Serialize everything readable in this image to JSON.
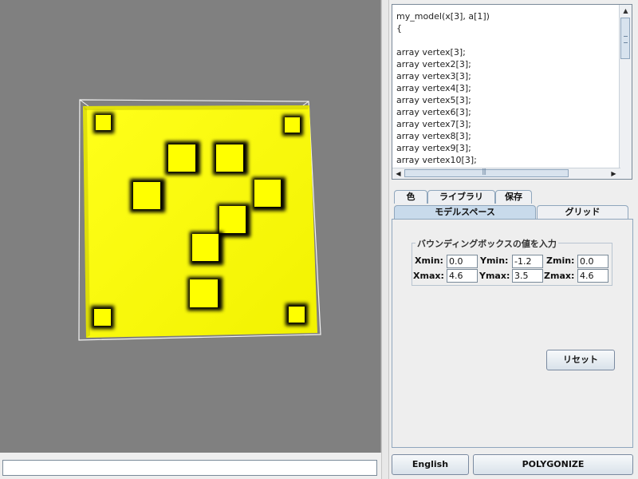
{
  "code_editor": {
    "lines": [
      "my_model(x[3], a[1])",
      "{",
      "",
      "array vertex[3];",
      "array vertex2[3];",
      "array vertex3[3];",
      "array vertex4[3];",
      "array vertex5[3];",
      "array vertex6[3];",
      "array vertex7[3];",
      "array vertex8[3];",
      "array vertex9[3];",
      "array vertex10[3];"
    ]
  },
  "tabs_top_row": [
    {
      "label": "色"
    },
    {
      "label": "ライブラリ"
    },
    {
      "label": "保存"
    }
  ],
  "tabs_bottom_row": [
    {
      "label": "モデルスペース",
      "active": true
    },
    {
      "label": "グリッド",
      "active": false
    }
  ],
  "bounding_box": {
    "legend": "バウンディングボックスの値を入力",
    "xmin_label": "Xmin:",
    "xmin": "0.0",
    "ymin_label": "Ymin:",
    "ymin": "-1.2",
    "zmin_label": "Zmin:",
    "zmin": "0.0",
    "xmax_label": "Xmax:",
    "xmax": "4.6",
    "ymax_label": "Ymax:",
    "ymax": "3.5",
    "zmax_label": "Zmax:",
    "zmax": "4.6"
  },
  "buttons": {
    "reset": "リセット",
    "language": "English",
    "polygonize": "POLYGONIZE"
  },
  "command_input": {
    "value": ""
  },
  "colors": {
    "viewport_bg": "#808080",
    "model_fill": "#ffff00",
    "tab_active": "#c8daeb"
  }
}
